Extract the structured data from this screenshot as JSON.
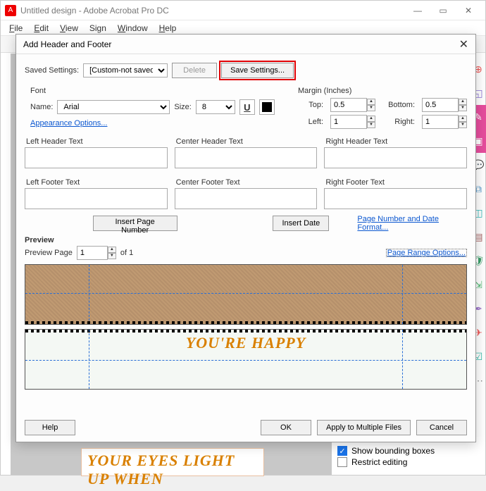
{
  "app": {
    "title": "Untitled design - Adobe Acrobat Pro DC",
    "menus": [
      "File",
      "Edit",
      "View",
      "Sign",
      "Window",
      "Help"
    ]
  },
  "dialog": {
    "title": "Add Header and Footer",
    "saved_settings_label": "Saved Settings:",
    "saved_settings_value": "[Custom-not saved]",
    "delete_label": "Delete",
    "save_label": "Save Settings...",
    "font": {
      "section": "Font",
      "name_label": "Name:",
      "name_value": "Arial",
      "size_label": "Size:",
      "size_value": "8",
      "underline_label": "U",
      "color": "#000000",
      "appearance_link": "Appearance Options..."
    },
    "margin": {
      "section": "Margin (Inches)",
      "top_label": "Top:",
      "top_value": "0.5",
      "bottom_label": "Bottom:",
      "bottom_value": "0.5",
      "left_label": "Left:",
      "left_value": "1",
      "right_label": "Right:",
      "right_value": "1"
    },
    "fields": {
      "lh": "Left Header Text",
      "ch": "Center Header Text",
      "rh": "Right Header Text",
      "lf": "Left Footer Text",
      "cf": "Center Footer Text",
      "rf": "Right Footer Text"
    },
    "insert_page_btn": "Insert Page Number",
    "insert_date_btn": "Insert Date",
    "pn_date_format_link": "Page Number and Date Format...",
    "preview": {
      "section": "Preview",
      "page_label": "Preview Page",
      "page_value": "1",
      "of_label": "of 1",
      "page_range_link": "Page Range Options...",
      "sample_text": "YOU'RE HAPPY"
    },
    "footer": {
      "help": "Help",
      "ok": "OK",
      "apply_multi": "Apply to Multiple Files",
      "cancel": "Cancel"
    }
  },
  "bottom_panel": {
    "show_bb": "Show bounding boxes",
    "restrict": "Restrict editing"
  },
  "canvas": {
    "text": "YOUR EYES LIGHT UP WHEN"
  }
}
